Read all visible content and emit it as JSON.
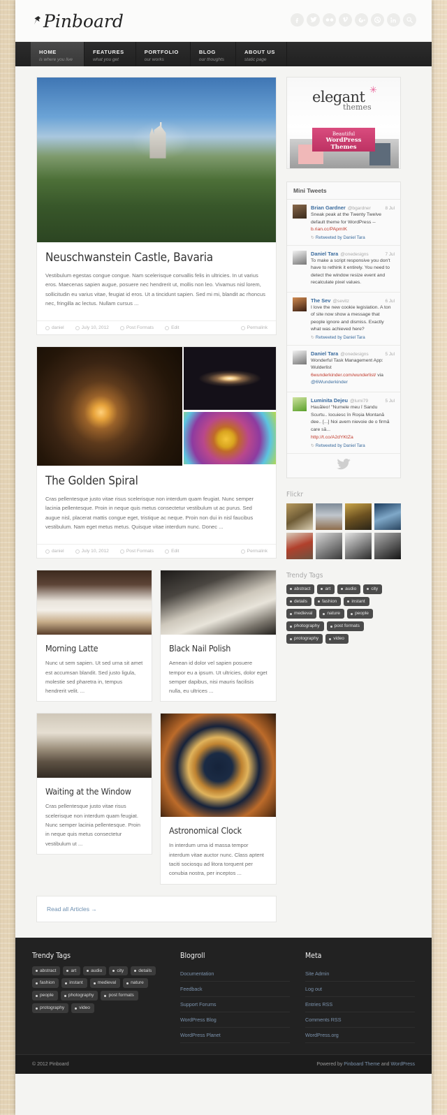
{
  "site": {
    "logo_text": "Pinboard",
    "logo_icon": "pushpin-icon"
  },
  "social_icons": [
    {
      "name": "facebook-icon",
      "glyph": "f"
    },
    {
      "name": "twitter-icon",
      "glyph": "t"
    },
    {
      "name": "flickr-icon",
      "glyph": "••"
    },
    {
      "name": "vimeo-icon",
      "glyph": "V"
    },
    {
      "name": "googleplus-icon",
      "glyph": "g"
    },
    {
      "name": "dribbble-icon",
      "glyph": "◎"
    },
    {
      "name": "linkedin-icon",
      "glyph": "in"
    },
    {
      "name": "search-icon",
      "glyph": "⚲"
    }
  ],
  "nav": [
    {
      "label": "HOME",
      "desc": "is where you live",
      "active": true
    },
    {
      "label": "FEATURES",
      "desc": "what you get",
      "active": false
    },
    {
      "label": "PORTFOLIO",
      "desc": "our works",
      "active": false
    },
    {
      "label": "BLOG",
      "desc": "our thoughts",
      "active": false
    },
    {
      "label": "ABOUT US",
      "desc": "static page",
      "active": false
    }
  ],
  "posts": {
    "castle": {
      "title": "Neuschwanstein Castle, Bavaria",
      "excerpt": "Vestibulum egestas congue congue. Nam scelerisque convallis felis in ultricies. In ut varius eros. Maecenas sapien augue, posuere nec hendrerit ut, mollis non leo. Vivamus nisl lorem, sollicitudin eu varius vitae, feugiat id eros. Ut a tincidunt sapien. Sed mi mi, blandit ac rhoncus nec, fringilla ac lectus. Nullam cursus ...",
      "meta": {
        "author": "daniel",
        "date": "July 10, 2012",
        "category": "Post Formats",
        "edit": "Edit",
        "permalink": "Permalink"
      }
    },
    "spiral": {
      "title": "The Golden Spiral",
      "excerpt": "Cras pellentesque justo vitae risus scelerisque non interdum quam feugiat. Nunc semper lacinia pellentesque. Proin in neque quis metus consectetur vestibulum ut ac purus. Sed augue nisl, placerat mattis congue eget, tristique ac neque. Proin non dui in nisl faucibus vestibulum. Nam eget metus metus. Quisque vitae interdum nunc. Donec ...",
      "meta": {
        "author": "daniel",
        "date": "July 10, 2012",
        "category": "Post Formats",
        "edit": "Edit",
        "permalink": "Permalink"
      }
    },
    "latte": {
      "title": "Morning Latte",
      "excerpt": "Nunc ut sem sapien. Ut sed urna sit amet est accumsan blandit. Sed justo ligula, molestie sed pharetra in, tempus hendrerit velit. ..."
    },
    "nails": {
      "title": "Black Nail Polish",
      "excerpt": "Aenean id dolor vel sapien posuere tempor eu a ipsum. Ut ultricies, dolor eget semper dapibus, nisi mauris facilisis nulla, eu ultrices ..."
    },
    "window": {
      "title": "Waiting at the Window",
      "excerpt": "Cras pellentesque justo vitae risus scelerisque non interdum quam feugiat. Nunc semper lacinia pellentesque. Proin in neque quis metus consectetur vestibulum ut ..."
    },
    "clock": {
      "title": "Astronomical Clock",
      "excerpt": "In interdum urna id massa tempor interdum vitae auctor nunc. Class aptent taciti sociosqu ad litora torquent per conubia nostra, per inceptos ..."
    }
  },
  "read_all": "Read all Articles →",
  "ad": {
    "brand": "elegant",
    "brand2": "themes",
    "tagline_small": "Beautiful",
    "tagline_big": "WordPress Themes"
  },
  "mini_tweets": {
    "title": "Mini Tweets",
    "items": [
      {
        "name": "Brian Gardner",
        "handle": "@bgardner",
        "date": "8 Jul",
        "text": "Sneak peak at the Twenty Twelve default theme for WordPress -- ",
        "link": "b.rian.cc/PApmIK",
        "retweet": "Retweeted by Daniel Tara",
        "avatar": "avatar-brian-gardner"
      },
      {
        "name": "Daniel Tara",
        "handle": "@onedesigns",
        "date": "7 Jul",
        "text": "To make a script responsive you don't have to rethink it entirely. You need to detect the window resize event and recalculate pixel values.",
        "link": "",
        "retweet": "",
        "avatar": "avatar-daniel-tara"
      },
      {
        "name": "The Sev",
        "handle": "@sevitz",
        "date": "6 Jul",
        "text": "I love the new cookie legislation. A ton of site now show a message that people ignore and dismiss. Exactly what was achieved here?",
        "link": "",
        "retweet": "Retweeted by Daniel Tara",
        "avatar": "avatar-the-sev"
      },
      {
        "name": "Daniel Tara",
        "handle": "@onedesigns",
        "date": "5 Jul",
        "text": "Wonderful Task Management App: Wulderlist ",
        "link": "6wunderkinder.com/wunderlist/",
        "link2": "@6Wunderkinder",
        "text2": " via ",
        "retweet": "",
        "avatar": "avatar-daniel-tara-2"
      },
      {
        "name": "Luminita Dejeu",
        "handle": "@lumi79",
        "date": "5 Jul",
        "text": "Hauăleo! \"Numele meu î Sandu Scurtu.. locuiesc în Roșia Montană dee.. [...] Noi avem nievoie de o firmă care să...",
        "link": "http://t.co/A2dYKtZa",
        "retweet": "Retweeted by Daniel Tara",
        "avatar": "avatar-luminita-dejeu"
      }
    ]
  },
  "flickr": {
    "title": "Flickr",
    "photos": [
      "flickr-photo-1",
      "flickr-photo-2",
      "flickr-photo-3",
      "flickr-photo-4",
      "flickr-photo-5",
      "flickr-photo-6",
      "flickr-photo-7",
      "flickr-photo-8"
    ]
  },
  "trendy_tags": {
    "title": "Trendy Tags",
    "tags": [
      "abstract",
      "art",
      "audio",
      "city",
      "details",
      "fashion",
      "instant",
      "medieval",
      "nature",
      "people",
      "photography",
      "post formats",
      "protography",
      "video"
    ]
  },
  "footer": {
    "trendy_tags": {
      "title": "Trendy Tags",
      "tags": [
        "abstract",
        "art",
        "audio",
        "city",
        "details",
        "fashion",
        "instant",
        "medieval",
        "nature",
        "people",
        "photography",
        "post formats",
        "protography",
        "video"
      ]
    },
    "blogroll": {
      "title": "Blogroll",
      "links": [
        "Documentation",
        "Feedback",
        "Support Forums",
        "WordPress Blog",
        "WordPress Planet"
      ]
    },
    "meta": {
      "title": "Meta",
      "links": [
        "Site Admin",
        "Log out",
        "Entries RSS",
        "Comments RSS",
        "WordPress.org"
      ]
    },
    "copyright": "© 2012 Pinboard",
    "credit_pre": "Powered by ",
    "credit_theme": "Pinboard Theme",
    "credit_mid": " and ",
    "credit_wp": "WordPress"
  },
  "colors": {
    "accent_link": "#7c93ad",
    "nav_bg": "#262626",
    "footer_bg": "#222222",
    "tag_bg": "#4b4b4b",
    "twitter_blue": "#3b6c9e",
    "tweet_link_red": "#c0392b"
  }
}
